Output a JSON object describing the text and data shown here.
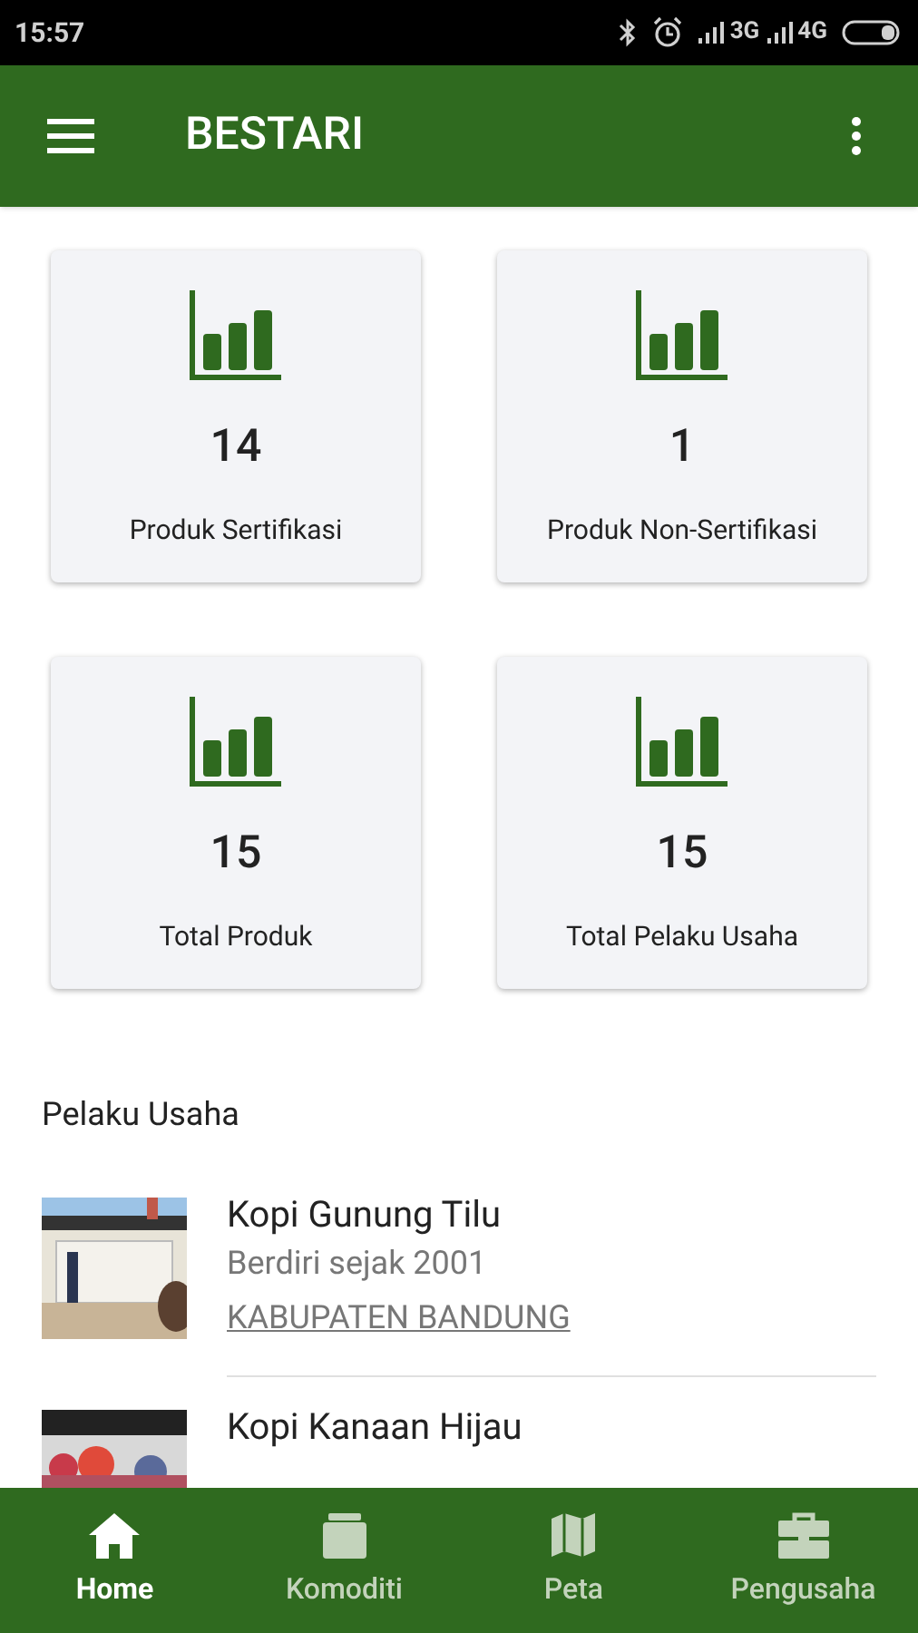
{
  "status_bar": {
    "time": "15:57",
    "network_1": "3G",
    "network_2": "4G"
  },
  "app_bar": {
    "title": "BESTARI"
  },
  "stats": [
    {
      "value": "14",
      "label": "Produk Sertifikasi"
    },
    {
      "value": "1",
      "label": "Produk Non-Sertifikasi"
    },
    {
      "value": "15",
      "label": "Total Produk"
    },
    {
      "value": "15",
      "label": "Total Pelaku Usaha"
    }
  ],
  "section_title": "Pelaku Usaha",
  "businesses": [
    {
      "name": "Kopi Gunung Tilu",
      "since": "Berdiri sejak 2001",
      "region": "KABUPATEN BANDUNG"
    },
    {
      "name": "Kopi Kanaan Hijau"
    }
  ],
  "bottom_nav": [
    {
      "label": "Home",
      "kind": "home",
      "selected": true
    },
    {
      "label": "Komoditi",
      "kind": "box",
      "selected": false
    },
    {
      "label": "Peta",
      "kind": "map",
      "selected": false
    },
    {
      "label": "Pengusaha",
      "kind": "briefcase",
      "selected": false
    }
  ]
}
